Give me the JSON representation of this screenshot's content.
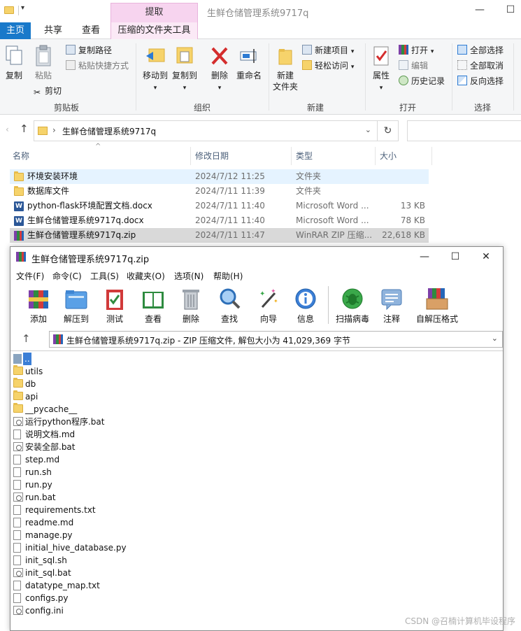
{
  "explorer": {
    "window_title": "生鲜仓储管理系统9717q",
    "context_tab": "提取",
    "ribbon_tabs": [
      "主页",
      "共享",
      "查看",
      "压缩的文件夹工具"
    ],
    "clipboard": {
      "copy": "复制",
      "paste": "粘贴",
      "copy_path": "复制路径",
      "paste_shortcut": "粘贴快捷方式",
      "cut": "剪切",
      "group": "剪贴板"
    },
    "organize": {
      "move_to": "移动到",
      "copy_to": "复制到",
      "delete": "删除",
      "rename": "重命名",
      "group": "组织"
    },
    "new_group": {
      "new_folder": "新建\n文件夹",
      "new_item": "新建项目",
      "easy_access": "轻松访问",
      "group": "新建"
    },
    "open_group": {
      "properties": "属性",
      "open": "打开",
      "edit": "编辑",
      "history": "历史记录",
      "group": "打开"
    },
    "select_group": {
      "select_all": "全部选择",
      "select_none": "全部取消",
      "invert": "反向选择",
      "group": "选择"
    },
    "address_path": "生鲜仓储管理系统9717q",
    "columns": {
      "name": "名称",
      "date": "修改日期",
      "type": "类型",
      "size": "大小"
    },
    "files": [
      {
        "name": "环境安装环境",
        "date": "2024/7/12 11:25",
        "type": "文件夹",
        "size": "",
        "icon": "folder"
      },
      {
        "name": "数据库文件",
        "date": "2024/7/11 11:39",
        "type": "文件夹",
        "size": "",
        "icon": "folder"
      },
      {
        "name": "python-flask环境配置文档.docx",
        "date": "2024/7/11 11:40",
        "type": "Microsoft Word ...",
        "size": "13 KB",
        "icon": "word"
      },
      {
        "name": "生鲜仓储管理系统9717q.docx",
        "date": "2024/7/11 11:40",
        "type": "Microsoft Word ...",
        "size": "78 KB",
        "icon": "word"
      },
      {
        "name": "生鲜仓储管理系统9717q.zip",
        "date": "2024/7/11 11:47",
        "type": "WinRAR ZIP 压缩...",
        "size": "22,618 KB",
        "icon": "rar"
      }
    ]
  },
  "winrar": {
    "title": "生鲜仓储管理系统9717q.zip",
    "menu": [
      "文件(F)",
      "命令(C)",
      "工具(S)",
      "收藏夹(O)",
      "选项(N)",
      "帮助(H)"
    ],
    "toolbar": [
      "添加",
      "解压到",
      "测试",
      "查看",
      "删除",
      "查找",
      "向导",
      "信息",
      "扫描病毒",
      "注释",
      "自解压格式"
    ],
    "path_text": "生鲜仓储管理系统9717q.zip - ZIP 压缩文件, 解包大小为 41,029,369 字节",
    "entries": [
      {
        "name": "..",
        "icon": "parent"
      },
      {
        "name": "utils",
        "icon": "folder"
      },
      {
        "name": "db",
        "icon": "folder"
      },
      {
        "name": "api",
        "icon": "folder"
      },
      {
        "name": "__pycache__",
        "icon": "folder"
      },
      {
        "name": "运行python程序.bat",
        "icon": "bat"
      },
      {
        "name": "说明文档.md",
        "icon": "doc"
      },
      {
        "name": "安装全部.bat",
        "icon": "bat"
      },
      {
        "name": "step.md",
        "icon": "doc"
      },
      {
        "name": "run.sh",
        "icon": "doc"
      },
      {
        "name": "run.py",
        "icon": "doc"
      },
      {
        "name": "run.bat",
        "icon": "bat"
      },
      {
        "name": "requirements.txt",
        "icon": "doc"
      },
      {
        "name": "readme.md",
        "icon": "doc"
      },
      {
        "name": "manage.py",
        "icon": "doc"
      },
      {
        "name": "initial_hive_database.py",
        "icon": "doc"
      },
      {
        "name": "init_sql.sh",
        "icon": "doc"
      },
      {
        "name": "init_sql.bat",
        "icon": "bat"
      },
      {
        "name": "datatype_map.txt",
        "icon": "doc"
      },
      {
        "name": "configs.py",
        "icon": "doc"
      },
      {
        "name": "config.ini",
        "icon": "bat"
      }
    ]
  },
  "watermark": "CSDN @召楠计算机毕设程序"
}
